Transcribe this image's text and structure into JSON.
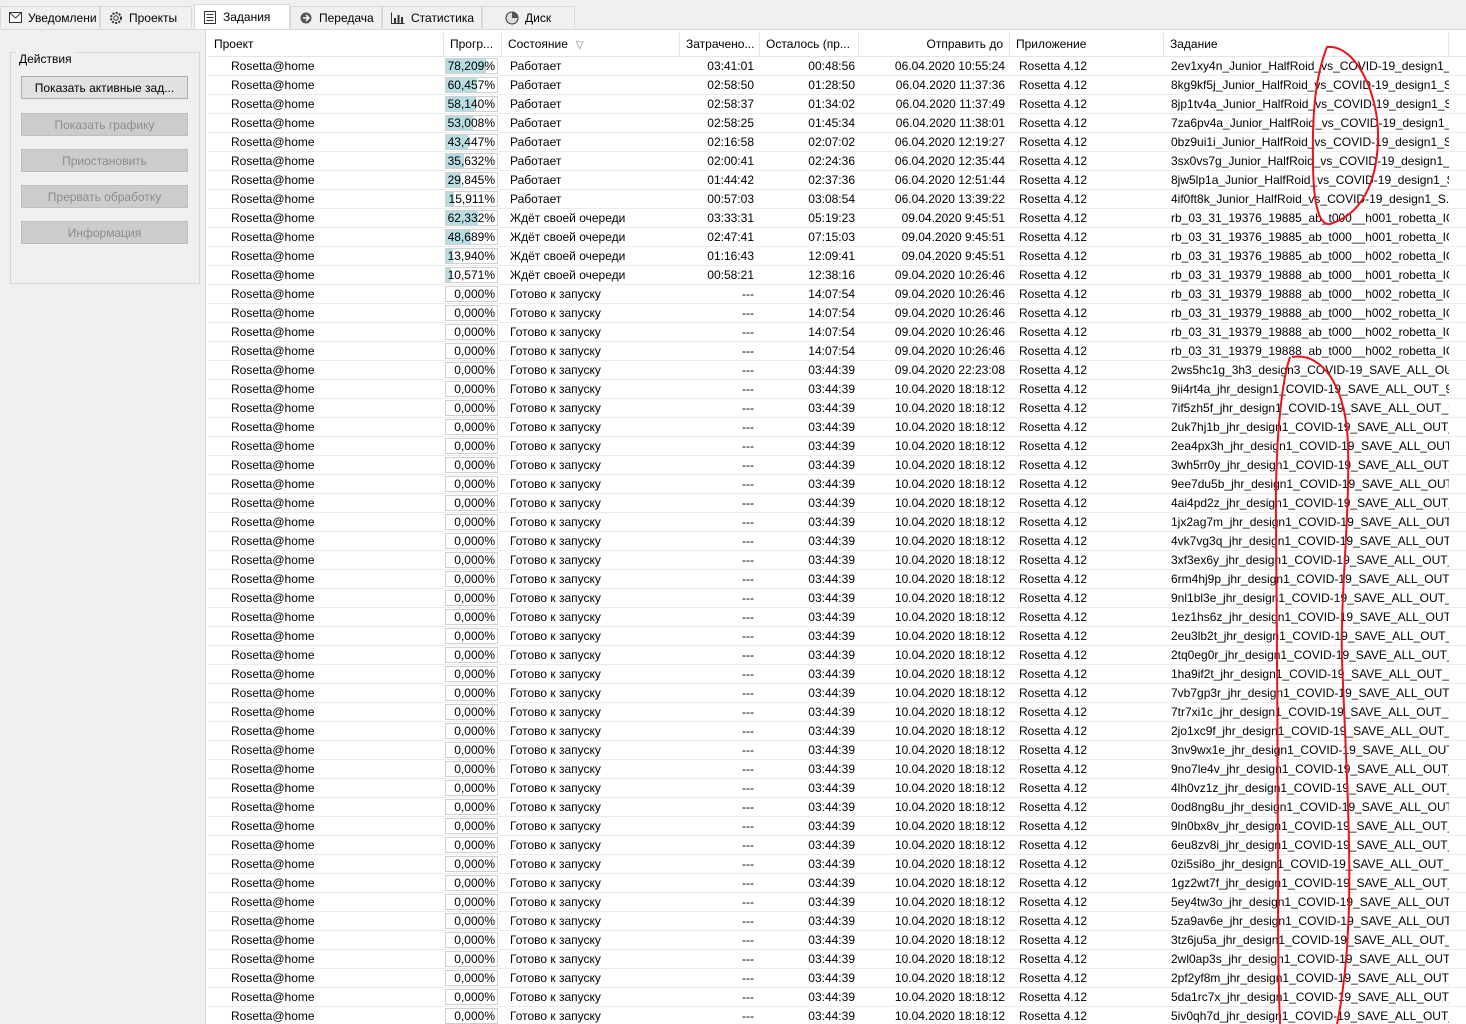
{
  "tabs": [
    {
      "label": "Уведомлени",
      "icon": "mail-icon"
    },
    {
      "label": "Проекты",
      "icon": "gear-icon"
    },
    {
      "label": "Задания",
      "icon": "list-icon"
    },
    {
      "label": "Передача",
      "icon": "transfer-icon"
    },
    {
      "label": "Статистика",
      "icon": "stats-icon"
    },
    {
      "label": "Диск",
      "icon": "disk-icon"
    }
  ],
  "active_tab": "Задания",
  "actions": {
    "title": "Действия",
    "show_active": "Показать активные зад...",
    "show_graphics": "Показать графику",
    "suspend": "Приостановить",
    "abort": "Прервать обработку",
    "info": "Информация"
  },
  "columns": {
    "project": "Проект",
    "progress": "Прогр...",
    "status": "Состояние",
    "elapsed": "Затрачено...",
    "remaining": "Осталось (пр...",
    "deadline": "Отправить до",
    "application": "Приложение",
    "task": "Задание"
  },
  "colors": {
    "progress_fill": "#b7dde2",
    "annotation": "#e8141e"
  },
  "rows": [
    {
      "project": "Rosetta@home",
      "progress": "78,209%",
      "pct": 0.78209,
      "status": "Работает",
      "elapsed": "03:41:01",
      "remaining": "00:48:56",
      "deadline": "06.04.2020 10:55:24",
      "app": "Rosetta 4.12",
      "task": "2ev1xy4n_Junior_HalfRoid_vs_COVID-19_design1_..."
    },
    {
      "project": "Rosetta@home",
      "progress": "60,457%",
      "pct": 0.60457,
      "status": "Работает",
      "elapsed": "02:58:50",
      "remaining": "01:28:50",
      "deadline": "06.04.2020 11:37:36",
      "app": "Rosetta 4.12",
      "task": "8kg9kf5j_Junior_HalfRoid_vs_COVID-19_design1_S..."
    },
    {
      "project": "Rosetta@home",
      "progress": "58,140%",
      "pct": 0.5814,
      "status": "Работает",
      "elapsed": "02:58:37",
      "remaining": "01:34:02",
      "deadline": "06.04.2020 11:37:49",
      "app": "Rosetta 4.12",
      "task": "8jp1tv4a_Junior_HalfRoid_vs_COVID-19_design1_S..."
    },
    {
      "project": "Rosetta@home",
      "progress": "53,008%",
      "pct": 0.53008,
      "status": "Работает",
      "elapsed": "02:58:25",
      "remaining": "01:45:34",
      "deadline": "06.04.2020 11:38:01",
      "app": "Rosetta 4.12",
      "task": "7za6pv4a_Junior_HalfRoid_vs_COVID-19_design1_..."
    },
    {
      "project": "Rosetta@home",
      "progress": "43,447%",
      "pct": 0.43447,
      "status": "Работает",
      "elapsed": "02:16:58",
      "remaining": "02:07:02",
      "deadline": "06.04.2020 12:19:27",
      "app": "Rosetta 4.12",
      "task": "0bz9ui1i_Junior_HalfRoid_vs_COVID-19_design1_S..."
    },
    {
      "project": "Rosetta@home",
      "progress": "35,632%",
      "pct": 0.35632,
      "status": "Работает",
      "elapsed": "02:00:41",
      "remaining": "02:24:36",
      "deadline": "06.04.2020 12:35:44",
      "app": "Rosetta 4.12",
      "task": "3sx0vs7g_Junior_HalfRoid_vs_COVID-19_design1_S..."
    },
    {
      "project": "Rosetta@home",
      "progress": "29,845%",
      "pct": 0.29845,
      "status": "Работает",
      "elapsed": "01:44:42",
      "remaining": "02:37:36",
      "deadline": "06.04.2020 12:51:44",
      "app": "Rosetta 4.12",
      "task": "8jw5lp1a_Junior_HalfRoid_vs_COVID-19_design1_S..."
    },
    {
      "project": "Rosetta@home",
      "progress": "15,911%",
      "pct": 0.15911,
      "status": "Работает",
      "elapsed": "00:57:03",
      "remaining": "03:08:54",
      "deadline": "06.04.2020 13:39:22",
      "app": "Rosetta 4.12",
      "task": "4if0ft8k_Junior_HalfRoid_vs_COVID-19_design1_S..."
    },
    {
      "project": "Rosetta@home",
      "progress": "62,332%",
      "pct": 0.62332,
      "status": "Ждёт своей очереди",
      "elapsed": "03:33:31",
      "remaining": "05:19:23",
      "deadline": "09.04.2020 9:45:51",
      "app": "Rosetta 4.12",
      "task": "rb_03_31_19376_19885_ab_t000__h001_robetta_IGN..."
    },
    {
      "project": "Rosetta@home",
      "progress": "48,689%",
      "pct": 0.48689,
      "status": "Ждёт своей очереди",
      "elapsed": "02:47:41",
      "remaining": "07:15:03",
      "deadline": "09.04.2020 9:45:51",
      "app": "Rosetta 4.12",
      "task": "rb_03_31_19376_19885_ab_t000__h001_robetta_IGN..."
    },
    {
      "project": "Rosetta@home",
      "progress": "13,940%",
      "pct": 0.1394,
      "status": "Ждёт своей очереди",
      "elapsed": "01:16:43",
      "remaining": "12:09:41",
      "deadline": "09.04.2020 9:45:51",
      "app": "Rosetta 4.12",
      "task": "rb_03_31_19376_19885_ab_t000__h002_robetta_IGN..."
    },
    {
      "project": "Rosetta@home",
      "progress": "10,571%",
      "pct": 0.10571,
      "status": "Ждёт своей очереди",
      "elapsed": "00:58:21",
      "remaining": "12:38:16",
      "deadline": "09.04.2020 10:26:46",
      "app": "Rosetta 4.12",
      "task": "rb_03_31_19379_19888_ab_t000__h001_robetta_IGN..."
    },
    {
      "project": "Rosetta@home",
      "progress": "0,000%",
      "pct": 0,
      "status": "Готово к запуску",
      "elapsed": "---",
      "remaining": "14:07:54",
      "deadline": "09.04.2020 10:26:46",
      "app": "Rosetta 4.12",
      "task": "rb_03_31_19379_19888_ab_t000__h002_robetta_IGN..."
    },
    {
      "project": "Rosetta@home",
      "progress": "0,000%",
      "pct": 0,
      "status": "Готово к запуску",
      "elapsed": "---",
      "remaining": "14:07:54",
      "deadline": "09.04.2020 10:26:46",
      "app": "Rosetta 4.12",
      "task": "rb_03_31_19379_19888_ab_t000__h002_robetta_IGN..."
    },
    {
      "project": "Rosetta@home",
      "progress": "0,000%",
      "pct": 0,
      "status": "Готово к запуску",
      "elapsed": "---",
      "remaining": "14:07:54",
      "deadline": "09.04.2020 10:26:46",
      "app": "Rosetta 4.12",
      "task": "rb_03_31_19379_19888_ab_t000__h002_robetta_IGN..."
    },
    {
      "project": "Rosetta@home",
      "progress": "0,000%",
      "pct": 0,
      "status": "Готово к запуску",
      "elapsed": "---",
      "remaining": "14:07:54",
      "deadline": "09.04.2020 10:26:46",
      "app": "Rosetta 4.12",
      "task": "rb_03_31_19379_19888_ab_t000__h002_robetta_IGN..."
    },
    {
      "project": "Rosetta@home",
      "progress": "0,000%",
      "pct": 0,
      "status": "Готово к запуску",
      "elapsed": "---",
      "remaining": "03:44:39",
      "deadline": "09.04.2020 22:23:08",
      "app": "Rosetta 4.12",
      "task": "2ws5hc1g_3h3_design3_COVID-19_SAVE_ALL_OUT..."
    },
    {
      "project": "Rosetta@home",
      "progress": "0,000%",
      "pct": 0,
      "status": "Готово к запуску",
      "elapsed": "---",
      "remaining": "03:44:39",
      "deadline": "10.04.2020 18:18:12",
      "app": "Rosetta 4.12",
      "task": "9ii4rt4a_jhr_design1_COVID-19_SAVE_ALL_OUT_90..."
    },
    {
      "project": "Rosetta@home",
      "progress": "0,000%",
      "pct": 0,
      "status": "Готово к запуску",
      "elapsed": "---",
      "remaining": "03:44:39",
      "deadline": "10.04.2020 18:18:12",
      "app": "Rosetta 4.12",
      "task": "7if5zh5f_jhr_design1_COVID-19_SAVE_ALL_OUT_9..."
    },
    {
      "project": "Rosetta@home",
      "progress": "0,000%",
      "pct": 0,
      "status": "Готово к запуску",
      "elapsed": "---",
      "remaining": "03:44:39",
      "deadline": "10.04.2020 18:18:12",
      "app": "Rosetta 4.12",
      "task": "2uk7hj1b_jhr_design1_COVID-19_SAVE_ALL_OUT_..."
    },
    {
      "project": "Rosetta@home",
      "progress": "0,000%",
      "pct": 0,
      "status": "Готово к запуску",
      "elapsed": "---",
      "remaining": "03:44:39",
      "deadline": "10.04.2020 18:18:12",
      "app": "Rosetta 4.12",
      "task": "2ea4px3h_jhr_design1_COVID-19_SAVE_ALL_OUT_..."
    },
    {
      "project": "Rosetta@home",
      "progress": "0,000%",
      "pct": 0,
      "status": "Готово к запуску",
      "elapsed": "---",
      "remaining": "03:44:39",
      "deadline": "10.04.2020 18:18:12",
      "app": "Rosetta 4.12",
      "task": "3wh5rr0y_jhr_design1_COVID-19_SAVE_ALL_OUT_..."
    },
    {
      "project": "Rosetta@home",
      "progress": "0,000%",
      "pct": 0,
      "status": "Готово к запуску",
      "elapsed": "---",
      "remaining": "03:44:39",
      "deadline": "10.04.2020 18:18:12",
      "app": "Rosetta 4.12",
      "task": "9ee7du5b_jhr_design1_COVID-19_SAVE_ALL_OUT_..."
    },
    {
      "project": "Rosetta@home",
      "progress": "0,000%",
      "pct": 0,
      "status": "Готово к запуску",
      "elapsed": "---",
      "remaining": "03:44:39",
      "deadline": "10.04.2020 18:18:12",
      "app": "Rosetta 4.12",
      "task": "4ai4pd2z_jhr_design1_COVID-19_SAVE_ALL_OUT_9..."
    },
    {
      "project": "Rosetta@home",
      "progress": "0,000%",
      "pct": 0,
      "status": "Готово к запуску",
      "elapsed": "---",
      "remaining": "03:44:39",
      "deadline": "10.04.2020 18:18:12",
      "app": "Rosetta 4.12",
      "task": "1jx2ag7m_jhr_design1_COVID-19_SAVE_ALL_OUT_..."
    },
    {
      "project": "Rosetta@home",
      "progress": "0,000%",
      "pct": 0,
      "status": "Готово к запуску",
      "elapsed": "---",
      "remaining": "03:44:39",
      "deadline": "10.04.2020 18:18:12",
      "app": "Rosetta 4.12",
      "task": "4vk7vg3q_jhr_design1_COVID-19_SAVE_ALL_OUT_..."
    },
    {
      "project": "Rosetta@home",
      "progress": "0,000%",
      "pct": 0,
      "status": "Готово к запуску",
      "elapsed": "---",
      "remaining": "03:44:39",
      "deadline": "10.04.2020 18:18:12",
      "app": "Rosetta 4.12",
      "task": "3xf3ex6y_jhr_design1_COVID-19_SAVE_ALL_OUT_9..."
    },
    {
      "project": "Rosetta@home",
      "progress": "0,000%",
      "pct": 0,
      "status": "Готово к запуску",
      "elapsed": "---",
      "remaining": "03:44:39",
      "deadline": "10.04.2020 18:18:12",
      "app": "Rosetta 4.12",
      "task": "6rm4hj9p_jhr_design1_COVID-19_SAVE_ALL_OUT_..."
    },
    {
      "project": "Rosetta@home",
      "progress": "0,000%",
      "pct": 0,
      "status": "Готово к запуску",
      "elapsed": "---",
      "remaining": "03:44:39",
      "deadline": "10.04.2020 18:18:12",
      "app": "Rosetta 4.12",
      "task": "9nl1bl3e_jhr_design1_COVID-19_SAVE_ALL_OUT_9..."
    },
    {
      "project": "Rosetta@home",
      "progress": "0,000%",
      "pct": 0,
      "status": "Готово к запуску",
      "elapsed": "---",
      "remaining": "03:44:39",
      "deadline": "10.04.2020 18:18:12",
      "app": "Rosetta 4.12",
      "task": "1ez1hs6z_jhr_design1_COVID-19_SAVE_ALL_OUT_9..."
    },
    {
      "project": "Rosetta@home",
      "progress": "0,000%",
      "pct": 0,
      "status": "Готово к запуску",
      "elapsed": "---",
      "remaining": "03:44:39",
      "deadline": "10.04.2020 18:18:12",
      "app": "Rosetta 4.12",
      "task": "2eu3lb2t_jhr_design1_COVID-19_SAVE_ALL_OUT_9..."
    },
    {
      "project": "Rosetta@home",
      "progress": "0,000%",
      "pct": 0,
      "status": "Готово к запуску",
      "elapsed": "---",
      "remaining": "03:44:39",
      "deadline": "10.04.2020 18:18:12",
      "app": "Rosetta 4.12",
      "task": "2tq0eg0r_jhr_design1_COVID-19_SAVE_ALL_OUT_9..."
    },
    {
      "project": "Rosetta@home",
      "progress": "0,000%",
      "pct": 0,
      "status": "Готово к запуску",
      "elapsed": "---",
      "remaining": "03:44:39",
      "deadline": "10.04.2020 18:18:12",
      "app": "Rosetta 4.12",
      "task": "1ha9if2t_jhr_design1_COVID-19_SAVE_ALL_OUT_..."
    },
    {
      "project": "Rosetta@home",
      "progress": "0,000%",
      "pct": 0,
      "status": "Готово к запуску",
      "elapsed": "---",
      "remaining": "03:44:39",
      "deadline": "10.04.2020 18:18:12",
      "app": "Rosetta 4.12",
      "task": "7vb7gp3r_jhr_design1_COVID-19_SAVE_ALL_OUT_..."
    },
    {
      "project": "Rosetta@home",
      "progress": "0,000%",
      "pct": 0,
      "status": "Готово к запуску",
      "elapsed": "---",
      "remaining": "03:44:39",
      "deadline": "10.04.2020 18:18:12",
      "app": "Rosetta 4.12",
      "task": "7tr7xi1c_jhr_design1_COVID-19_SAVE_ALL_OUT_90..."
    },
    {
      "project": "Rosetta@home",
      "progress": "0,000%",
      "pct": 0,
      "status": "Готово к запуску",
      "elapsed": "---",
      "remaining": "03:44:39",
      "deadline": "10.04.2020 18:18:12",
      "app": "Rosetta 4.12",
      "task": "2jo1xc9f_jhr_design1_COVID-19_SAVE_ALL_OUT_9..."
    },
    {
      "project": "Rosetta@home",
      "progress": "0,000%",
      "pct": 0,
      "status": "Готово к запуску",
      "elapsed": "---",
      "remaining": "03:44:39",
      "deadline": "10.04.2020 18:18:12",
      "app": "Rosetta 4.12",
      "task": "3nv9wx1e_jhr_design1_COVID-19_SAVE_ALL_OUT_..."
    },
    {
      "project": "Rosetta@home",
      "progress": "0,000%",
      "pct": 0,
      "status": "Готово к запуску",
      "elapsed": "---",
      "remaining": "03:44:39",
      "deadline": "10.04.2020 18:18:12",
      "app": "Rosetta 4.12",
      "task": "9no7le4v_jhr_design1_COVID-19_SAVE_ALL_OUT_..."
    },
    {
      "project": "Rosetta@home",
      "progress": "0,000%",
      "pct": 0,
      "status": "Готово к запуску",
      "elapsed": "---",
      "remaining": "03:44:39",
      "deadline": "10.04.2020 18:18:12",
      "app": "Rosetta 4.12",
      "task": "4lh0vz1z_jhr_design1_COVID-19_SAVE_ALL_OUT_9..."
    },
    {
      "project": "Rosetta@home",
      "progress": "0,000%",
      "pct": 0,
      "status": "Готово к запуску",
      "elapsed": "---",
      "remaining": "03:44:39",
      "deadline": "10.04.2020 18:18:12",
      "app": "Rosetta 4.12",
      "task": "0od8ng8u_jhr_design1_COVID-19_SAVE_ALL_OUT..."
    },
    {
      "project": "Rosetta@home",
      "progress": "0,000%",
      "pct": 0,
      "status": "Готово к запуску",
      "elapsed": "---",
      "remaining": "03:44:39",
      "deadline": "10.04.2020 18:18:12",
      "app": "Rosetta 4.12",
      "task": "9ln0bx8v_jhr_design1_COVID-19_SAVE_ALL_OUT_9..."
    },
    {
      "project": "Rosetta@home",
      "progress": "0,000%",
      "pct": 0,
      "status": "Готово к запуску",
      "elapsed": "---",
      "remaining": "03:44:39",
      "deadline": "10.04.2020 18:18:12",
      "app": "Rosetta 4.12",
      "task": "6eu8zv8i_jhr_design1_COVID-19_SAVE_ALL_OUT_9..."
    },
    {
      "project": "Rosetta@home",
      "progress": "0,000%",
      "pct": 0,
      "status": "Готово к запуску",
      "elapsed": "---",
      "remaining": "03:44:39",
      "deadline": "10.04.2020 18:18:12",
      "app": "Rosetta 4.12",
      "task": "0zi5si8o_jhr_design1_COVID-19_SAVE_ALL_OUT_9..."
    },
    {
      "project": "Rosetta@home",
      "progress": "0,000%",
      "pct": 0,
      "status": "Готово к запуску",
      "elapsed": "---",
      "remaining": "03:44:39",
      "deadline": "10.04.2020 18:18:12",
      "app": "Rosetta 4.12",
      "task": "1gz2wt7f_jhr_design1_COVID-19_SAVE_ALL_OUT_..."
    },
    {
      "project": "Rosetta@home",
      "progress": "0,000%",
      "pct": 0,
      "status": "Готово к запуску",
      "elapsed": "---",
      "remaining": "03:44:39",
      "deadline": "10.04.2020 18:18:12",
      "app": "Rosetta 4.12",
      "task": "5ey4tw3o_jhr_design1_COVID-19_SAVE_ALL_OUT_..."
    },
    {
      "project": "Rosetta@home",
      "progress": "0,000%",
      "pct": 0,
      "status": "Готово к запуску",
      "elapsed": "---",
      "remaining": "03:44:39",
      "deadline": "10.04.2020 18:18:12",
      "app": "Rosetta 4.12",
      "task": "5za9av6e_jhr_design1_COVID-19_SAVE_ALL_OUT_9..."
    },
    {
      "project": "Rosetta@home",
      "progress": "0,000%",
      "pct": 0,
      "status": "Готово к запуску",
      "elapsed": "---",
      "remaining": "03:44:39",
      "deadline": "10.04.2020 18:18:12",
      "app": "Rosetta 4.12",
      "task": "3tz6ju5a_jhr_design1_COVID-19_SAVE_ALL_OUT_9..."
    },
    {
      "project": "Rosetta@home",
      "progress": "0,000%",
      "pct": 0,
      "status": "Готово к запуску",
      "elapsed": "---",
      "remaining": "03:44:39",
      "deadline": "10.04.2020 18:18:12",
      "app": "Rosetta 4.12",
      "task": "2wl0ap3s_jhr_design1_COVID-19_SAVE_ALL_OUT_..."
    },
    {
      "project": "Rosetta@home",
      "progress": "0,000%",
      "pct": 0,
      "status": "Готово к запуску",
      "elapsed": "---",
      "remaining": "03:44:39",
      "deadline": "10.04.2020 18:18:12",
      "app": "Rosetta 4.12",
      "task": "2pf2yf8m_jhr_design1_COVID-19_SAVE_ALL_OUT_..."
    },
    {
      "project": "Rosetta@home",
      "progress": "0,000%",
      "pct": 0,
      "status": "Готово к запуску",
      "elapsed": "---",
      "remaining": "03:44:39",
      "deadline": "10.04.2020 18:18:12",
      "app": "Rosetta 4.12",
      "task": "5da1rc7x_jhr_design1_COVID-19_SAVE_ALL_OUT_..."
    },
    {
      "project": "Rosetta@home",
      "progress": "0,000%",
      "pct": 0,
      "status": "Готово к запуску",
      "elapsed": "---",
      "remaining": "03:44:39",
      "deadline": "10.04.2020 18:18:12",
      "app": "Rosetta 4.12",
      "task": "5iv0qh7d_jhr_design1_COVID-19_SAVE_ALL_OUT_..."
    }
  ]
}
